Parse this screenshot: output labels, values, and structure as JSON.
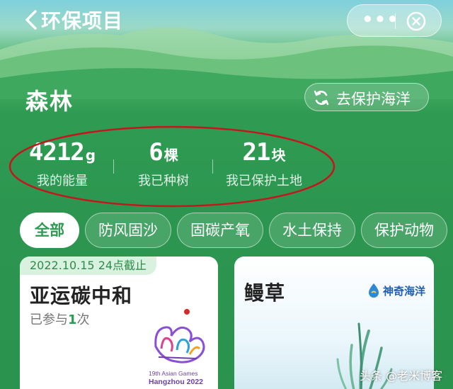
{
  "nav": {
    "title": "环保项目",
    "more_label": "•••"
  },
  "header": {
    "current_area": "森林",
    "switch_button": "去保护海洋"
  },
  "stats": [
    {
      "value": "4212",
      "unit": "g",
      "caption": "我的能量"
    },
    {
      "value": "6",
      "unit": "棵",
      "caption": "我已种树"
    },
    {
      "value": "21",
      "unit": "块",
      "caption": "我已保护土地"
    }
  ],
  "tabs": [
    {
      "label": "全部",
      "active": true
    },
    {
      "label": "防风固沙",
      "active": false
    },
    {
      "label": "固碳产氧",
      "active": false
    },
    {
      "label": "水土保持",
      "active": false
    },
    {
      "label": "保护动物",
      "active": false
    }
  ],
  "cards": [
    {
      "deadline": "2022.10.15 24点截止",
      "title": "亚运碳中和",
      "joined_prefix": "已参与",
      "joined_count": "1",
      "joined_suffix": "次",
      "logo_text_1": "19th Asian Games",
      "logo_text_2": "Hangzhou 2022"
    },
    {
      "title": "鳗草",
      "brand": "神奇海洋"
    }
  ],
  "watermark": "头条 @老米博客",
  "colors": {
    "primary_green": "#2f9b52",
    "annotation_red": "#c4161c"
  },
  "icons": {
    "back": "chevron-left-icon",
    "close": "close-circle-icon",
    "switch": "refresh-icon",
    "brand": "water-drop-icon"
  }
}
